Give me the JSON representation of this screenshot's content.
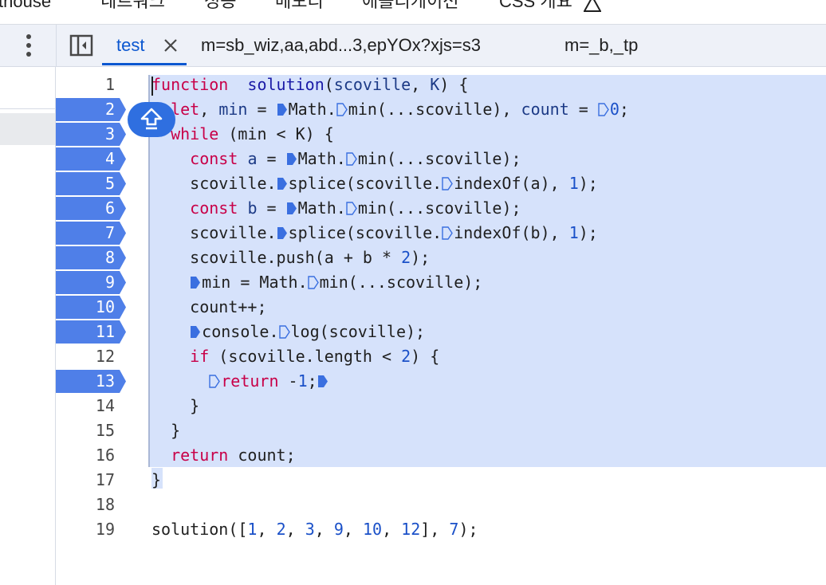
{
  "top_panel_tabs": [
    "thouse",
    "네트워크",
    "성능",
    "메모리",
    "애플리케이션",
    "CSS 개요"
  ],
  "file_tabs": [
    {
      "label": "test",
      "active": true,
      "closable": true
    },
    {
      "label": "m=sb_wiz,aa,abd...3,epYOx?xjs=s3",
      "active": false
    },
    {
      "label": "m=_b,_tp",
      "active": false
    }
  ],
  "editor": {
    "lines": [
      {
        "n": "1",
        "bp": false
      },
      {
        "n": "2",
        "bp": true
      },
      {
        "n": "3",
        "bp": true
      },
      {
        "n": "4",
        "bp": true
      },
      {
        "n": "5",
        "bp": true
      },
      {
        "n": "6",
        "bp": true
      },
      {
        "n": "7",
        "bp": true
      },
      {
        "n": "8",
        "bp": true
      },
      {
        "n": "9",
        "bp": true
      },
      {
        "n": "10",
        "bp": true
      },
      {
        "n": "11",
        "bp": true
      },
      {
        "n": "12",
        "bp": false
      },
      {
        "n": "13",
        "bp": true
      },
      {
        "n": "14",
        "bp": false
      },
      {
        "n": "15",
        "bp": false
      },
      {
        "n": "16",
        "bp": false
      },
      {
        "n": "17",
        "bp": false
      },
      {
        "n": "18",
        "bp": false
      },
      {
        "n": "19",
        "bp": false
      }
    ],
    "code": [
      [
        [
          "kw",
          "function"
        ],
        [
          "",
          "  "
        ],
        [
          "fn",
          "solution"
        ],
        [
          "",
          "("
        ],
        [
          "vr",
          "scoville"
        ],
        [
          "",
          ", "
        ],
        [
          "vr",
          "K"
        ],
        [
          "",
          ") {"
        ]
      ],
      [
        [
          "",
          "  "
        ],
        [
          "kw",
          "let"
        ],
        [
          "",
          ", "
        ],
        [
          "vr",
          "min"
        ],
        [
          "",
          " = "
        ],
        [
          "mk",
          "solid"
        ],
        [
          "",
          "Math."
        ],
        [
          "mk",
          "hollow"
        ],
        [
          "",
          "min(...scoville), "
        ],
        [
          "vr",
          "count"
        ],
        [
          "",
          " = "
        ],
        [
          "mk",
          "hollow"
        ],
        [
          "num",
          "0"
        ],
        [
          "",
          ";"
        ]
      ],
      [
        [
          "",
          "  "
        ],
        [
          "kw",
          "while"
        ],
        [
          "",
          " (min < K) {"
        ]
      ],
      [
        [
          "",
          "    "
        ],
        [
          "kw",
          "const"
        ],
        [
          "",
          " "
        ],
        [
          "vr",
          "a"
        ],
        [
          "",
          " = "
        ],
        [
          "mk",
          "solid"
        ],
        [
          "",
          "Math."
        ],
        [
          "mk",
          "hollow"
        ],
        [
          "",
          "min(...scoville);"
        ]
      ],
      [
        [
          "",
          "    scoville."
        ],
        [
          "mk",
          "solid"
        ],
        [
          "",
          "splice(scoville."
        ],
        [
          "mk",
          "hollow"
        ],
        [
          "",
          "indexOf(a), "
        ],
        [
          "num",
          "1"
        ],
        [
          "",
          ");"
        ]
      ],
      [
        [
          "",
          "    "
        ],
        [
          "kw",
          "const"
        ],
        [
          "",
          " "
        ],
        [
          "vr",
          "b"
        ],
        [
          "",
          " = "
        ],
        [
          "mk",
          "solid"
        ],
        [
          "",
          "Math."
        ],
        [
          "mk",
          "hollow"
        ],
        [
          "",
          "min(...scoville);"
        ]
      ],
      [
        [
          "",
          "    scoville."
        ],
        [
          "mk",
          "solid"
        ],
        [
          "",
          "splice(scoville."
        ],
        [
          "mk",
          "hollow"
        ],
        [
          "",
          "indexOf(b), "
        ],
        [
          "num",
          "1"
        ],
        [
          "",
          ");"
        ]
      ],
      [
        [
          "",
          "    scoville.push(a + b * "
        ],
        [
          "num",
          "2"
        ],
        [
          "",
          ");"
        ]
      ],
      [
        [
          "",
          "    "
        ],
        [
          "mk",
          "solid"
        ],
        [
          "",
          "min = Math."
        ],
        [
          "mk",
          "hollow"
        ],
        [
          "",
          "min(...scoville);"
        ]
      ],
      [
        [
          "",
          "    count++;"
        ]
      ],
      [
        [
          "",
          "    "
        ],
        [
          "mk",
          "solid"
        ],
        [
          "",
          "console."
        ],
        [
          "mk",
          "hollow"
        ],
        [
          "",
          "log(scoville);"
        ]
      ],
      [
        [
          "",
          "    "
        ],
        [
          "kw",
          "if"
        ],
        [
          "",
          " (scoville.length < "
        ],
        [
          "num",
          "2"
        ],
        [
          "",
          ") {"
        ]
      ],
      [
        [
          "",
          "      "
        ],
        [
          "mk",
          "hollow"
        ],
        [
          "kw",
          "return"
        ],
        [
          "",
          " -"
        ],
        [
          "num",
          "1"
        ],
        [
          "",
          ";"
        ],
        [
          "mk",
          "solid"
        ]
      ],
      [
        [
          "",
          "    }"
        ]
      ],
      [
        [
          "",
          "  }"
        ]
      ],
      [
        [
          "",
          "  "
        ],
        [
          "kw",
          "return"
        ],
        [
          "",
          " count;"
        ]
      ],
      [
        [
          "",
          "}"
        ]
      ],
      [
        [
          "",
          ""
        ]
      ],
      [
        [
          "",
          "solution(["
        ],
        [
          "num",
          "1"
        ],
        [
          "",
          ", "
        ],
        [
          "num",
          "2"
        ],
        [
          "",
          ", "
        ],
        [
          "num",
          "3"
        ],
        [
          "",
          ", "
        ],
        [
          "num",
          "9"
        ],
        [
          "",
          ", "
        ],
        [
          "num",
          "10"
        ],
        [
          "",
          ", "
        ],
        [
          "num",
          "12"
        ],
        [
          "",
          "], "
        ],
        [
          "num",
          "7"
        ],
        [
          "",
          ");"
        ]
      ]
    ]
  },
  "colors": {
    "breakpoint": "#4f7fe8",
    "accent": "#0b57d0",
    "selection": "#d6e2fb"
  },
  "icons": {
    "menu": "more-vert-icon",
    "sidebar": "toggle-navigator-icon",
    "close": "close-icon",
    "step": "step-out-icon",
    "warning": "warning-triangle-icon"
  }
}
